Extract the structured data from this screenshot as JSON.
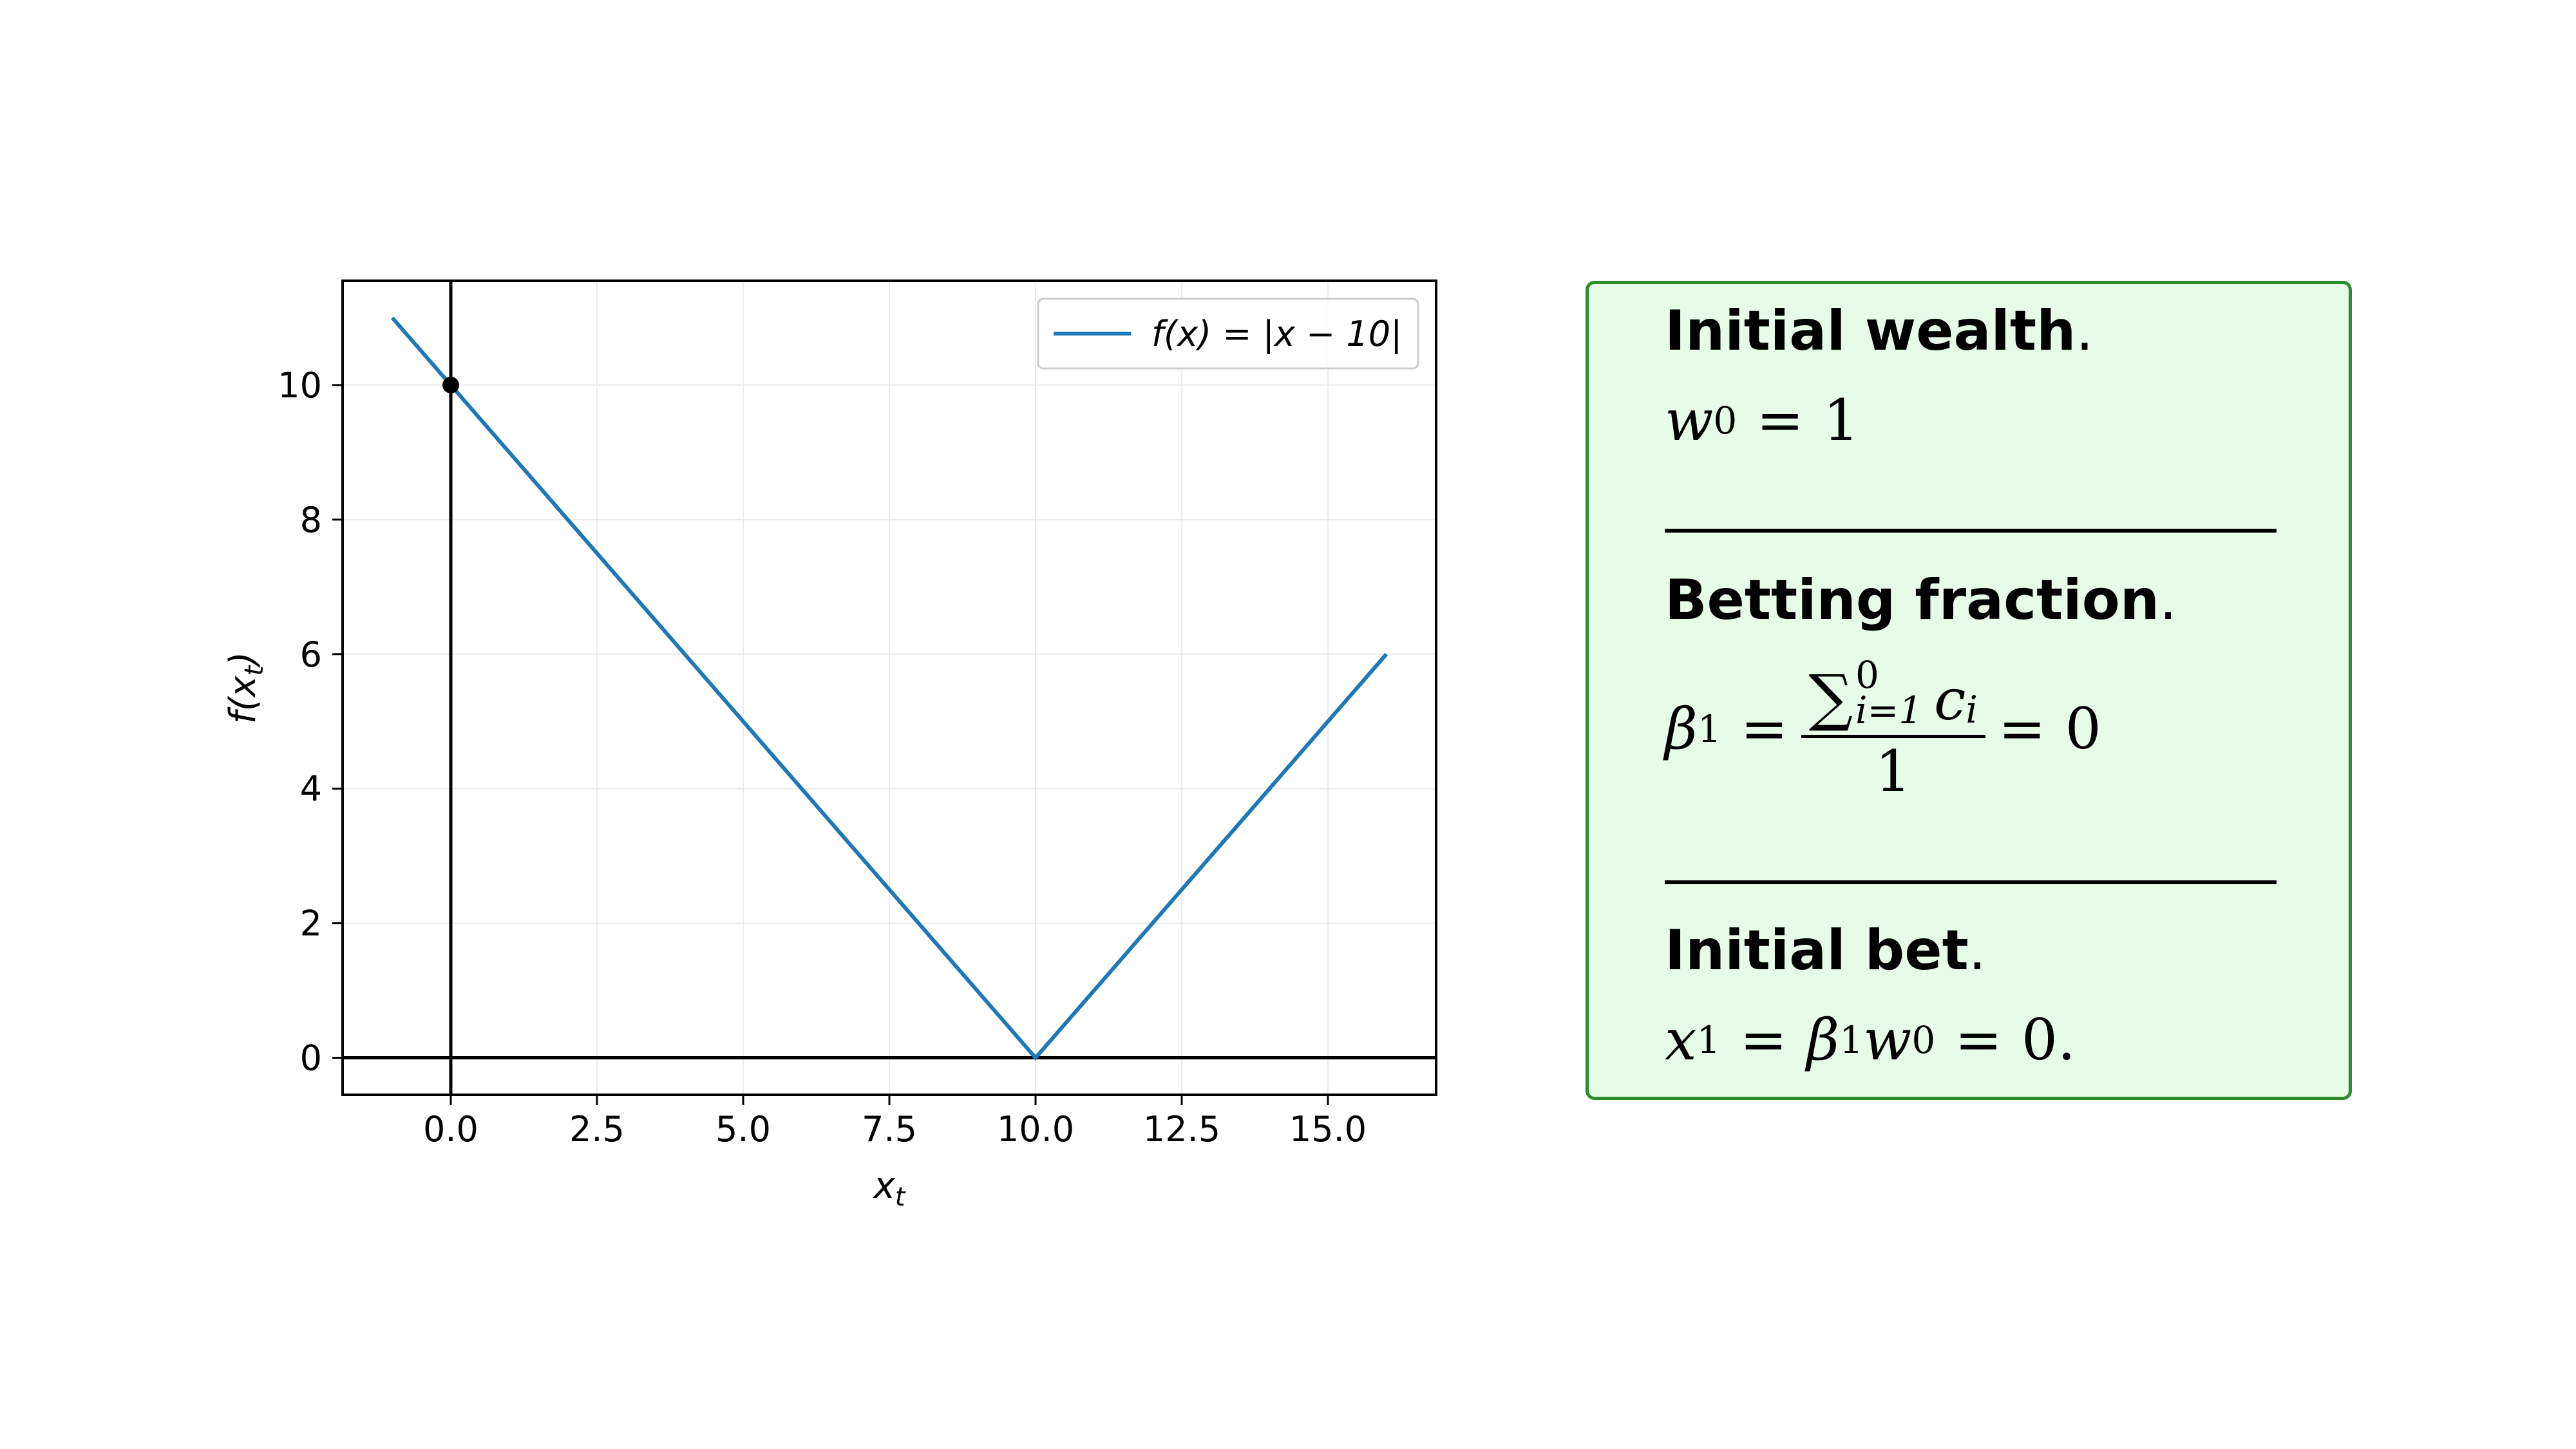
{
  "chart_data": {
    "type": "line",
    "xlabel": "x_t",
    "ylabel": "f(x_t)",
    "xlim": [
      -1.85,
      16.85
    ],
    "ylim": [
      -0.55,
      11.55
    ],
    "xticks": [
      0.0,
      2.5,
      5.0,
      7.5,
      10.0,
      12.5,
      15.0
    ],
    "xtick_labels": [
      "0.0",
      "2.5",
      "5.0",
      "7.5",
      "10.0",
      "12.5",
      "15.0"
    ],
    "yticks": [
      0,
      2,
      4,
      6,
      8,
      10
    ],
    "ytick_labels": [
      "0",
      "2",
      "4",
      "6",
      "8",
      "10"
    ],
    "grid": true,
    "legend_position": "top-right",
    "series": [
      {
        "name": "f(x) = |x − 10|",
        "color": "#1f77b4",
        "x": [
          -1,
          10,
          16
        ],
        "y": [
          11,
          0,
          6
        ]
      }
    ],
    "point": {
      "x": 0,
      "y": 10,
      "color": "#000000"
    },
    "reference_lines": {
      "vertical_x": 0,
      "horizontal_y": 0,
      "color": "#000000"
    }
  },
  "panel": {
    "background": "#e6fce6",
    "border_color": "#2e8b2e",
    "sections": [
      {
        "heading": "Initial wealth",
        "punct": "."
      },
      {
        "heading": "Betting fraction",
        "punct": "."
      },
      {
        "heading": "Initial bet",
        "punct": "."
      }
    ],
    "formulas": {
      "wealth": {
        "var": "w",
        "sub": "0",
        "eq": "=",
        "value": "1"
      },
      "fraction": {
        "var": "β",
        "sub": "1",
        "eq": "=",
        "sum_symbol": "∑",
        "upper": "0",
        "lower": "i=1",
        "term": "c",
        "term_sub": "i",
        "denominator": "1",
        "eq2": "=",
        "value": "0"
      },
      "bet": {
        "var": "x",
        "sub": "1",
        "eq": "=",
        "beta": "β",
        "beta_sub": "1",
        "w": "w",
        "w_sub": "0",
        "eq2": "=",
        "value": "0."
      }
    }
  }
}
